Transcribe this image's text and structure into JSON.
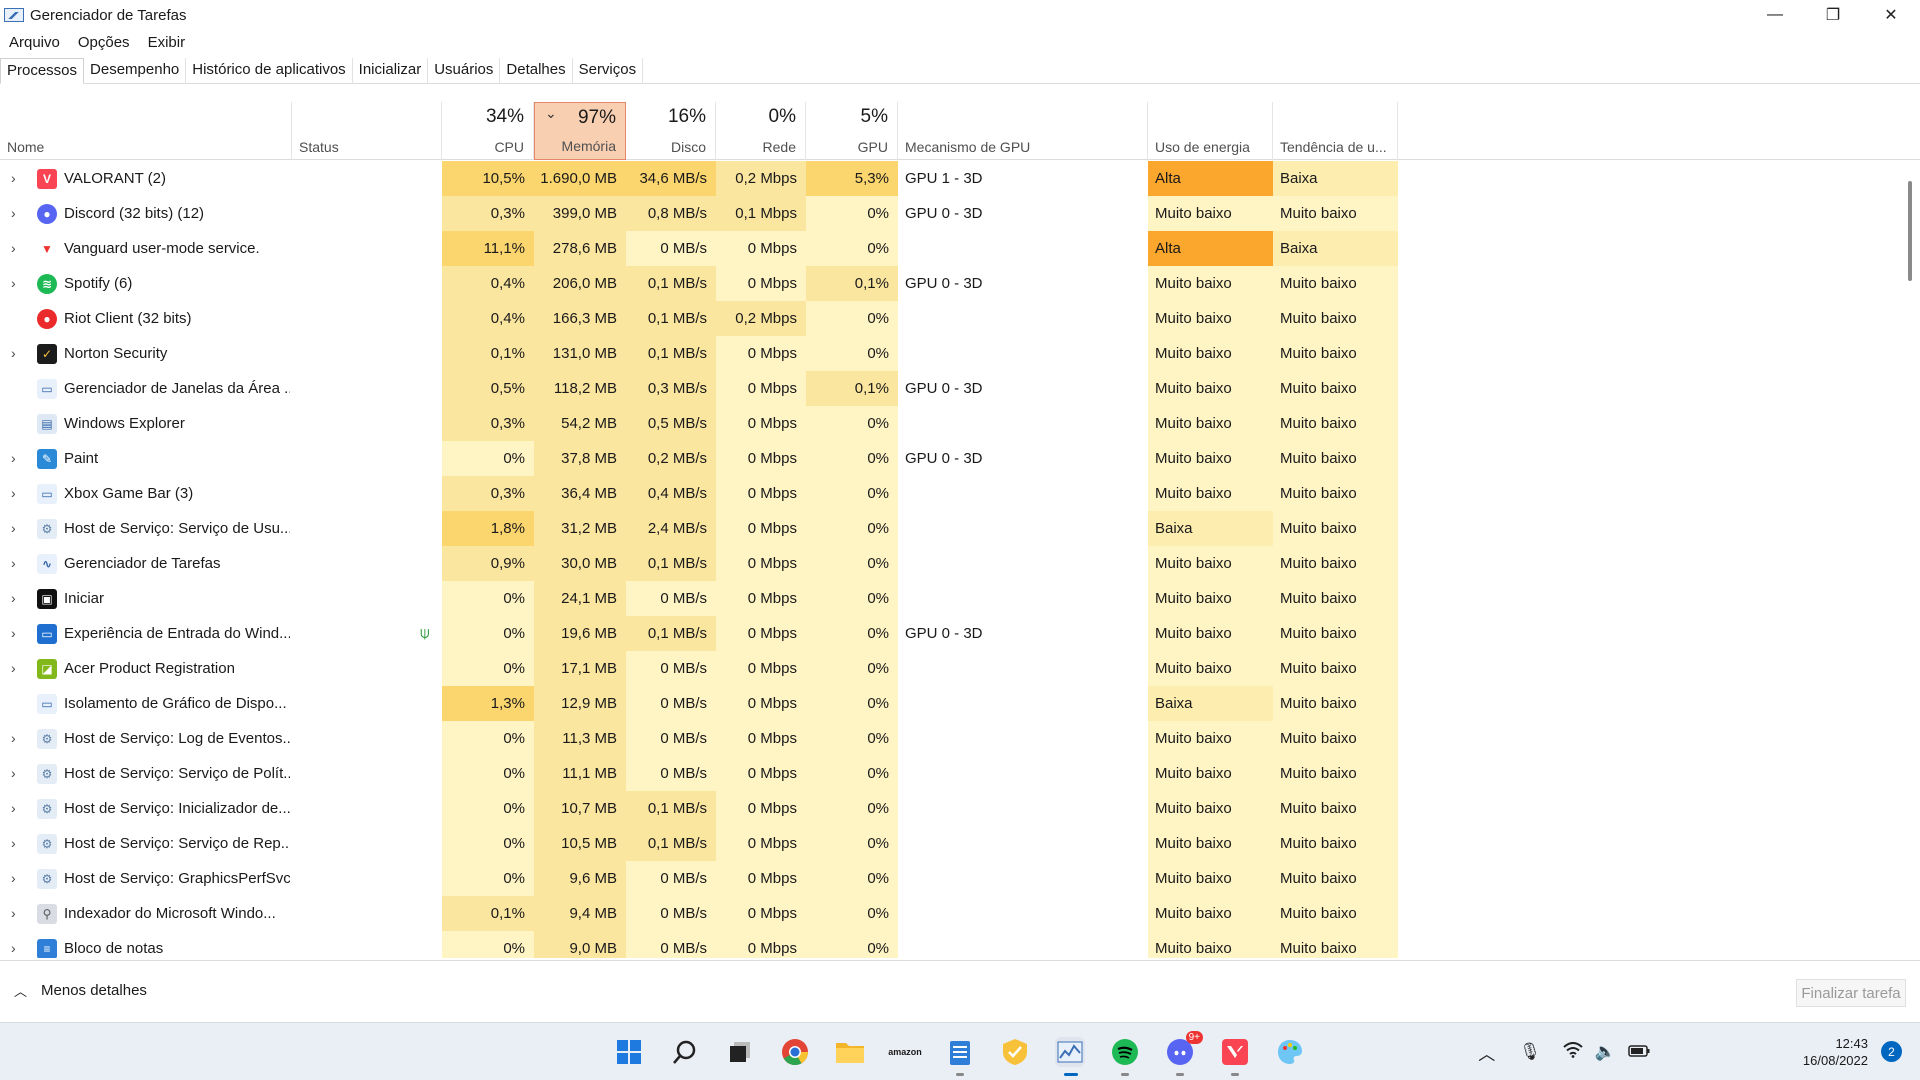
{
  "window": {
    "title": "Gerenciador de Tarefas",
    "minimize": "—",
    "restore": "❐",
    "close": "✕"
  },
  "menu": [
    "Arquivo",
    "Opções",
    "Exibir"
  ],
  "tabs": [
    "Processos",
    "Desempenho",
    "Histórico de aplicativos",
    "Inicializar",
    "Usuários",
    "Detalhes",
    "Serviços"
  ],
  "header": {
    "name": "Nome",
    "status": "Status",
    "cpu_pct": "34%",
    "cpu": "CPU",
    "mem_pct": "97%",
    "mem": "Memória",
    "disk_pct": "16%",
    "disk": "Disco",
    "net_pct": "0%",
    "net": "Rede",
    "gpu_pct": "5%",
    "gpu": "GPU",
    "gpu_engine": "Mecanismo de GPU",
    "power": "Uso de energia",
    "power_trend": "Tendência de u..."
  },
  "processes": [
    {
      "name": "VALORANT (2)",
      "icon": "valorant-icon",
      "exp": true,
      "cpu": "10,5%",
      "mem": "1.690,0 MB",
      "disk": "34,6 MB/s",
      "net": "0,2 Mbps",
      "gpu": "5,3%",
      "engine": "GPU 1 - 3D",
      "power": "Alta",
      "trend": "Baixa"
    },
    {
      "name": "Discord (32 bits) (12)",
      "icon": "discord-icon",
      "exp": true,
      "cpu": "0,3%",
      "mem": "399,0 MB",
      "disk": "0,8 MB/s",
      "net": "0,1 Mbps",
      "gpu": "0%",
      "engine": "GPU 0 - 3D",
      "power": "Muito baixo",
      "trend": "Muito baixo"
    },
    {
      "name": "Vanguard user-mode service.",
      "icon": "vanguard-icon",
      "exp": true,
      "cpu": "11,1%",
      "mem": "278,6 MB",
      "disk": "0 MB/s",
      "net": "0 Mbps",
      "gpu": "0%",
      "engine": "",
      "power": "Alta",
      "trend": "Baixa"
    },
    {
      "name": "Spotify (6)",
      "icon": "spotify-icon",
      "exp": true,
      "cpu": "0,4%",
      "mem": "206,0 MB",
      "disk": "0,1 MB/s",
      "net": "0 Mbps",
      "gpu": "0,1%",
      "engine": "GPU 0 - 3D",
      "power": "Muito baixo",
      "trend": "Muito baixo"
    },
    {
      "name": "Riot Client (32 bits)",
      "icon": "riot-client-icon",
      "exp": false,
      "cpu": "0,4%",
      "mem": "166,3 MB",
      "disk": "0,1 MB/s",
      "net": "0,2 Mbps",
      "gpu": "0%",
      "engine": "",
      "power": "Muito baixo",
      "trend": "Muito baixo"
    },
    {
      "name": "Norton Security",
      "icon": "norton-icon",
      "exp": true,
      "cpu": "0,1%",
      "mem": "131,0 MB",
      "disk": "0,1 MB/s",
      "net": "0 Mbps",
      "gpu": "0%",
      "engine": "",
      "power": "Muito baixo",
      "trend": "Muito baixo"
    },
    {
      "name": "Gerenciador de Janelas da Área ...",
      "icon": "window-icon",
      "exp": false,
      "cpu": "0,5%",
      "mem": "118,2 MB",
      "disk": "0,3 MB/s",
      "net": "0 Mbps",
      "gpu": "0,1%",
      "engine": "GPU 0 - 3D",
      "power": "Muito baixo",
      "trend": "Muito baixo"
    },
    {
      "name": "Windows Explorer",
      "icon": "explorer-icon",
      "exp": false,
      "cpu": "0,3%",
      "mem": "54,2 MB",
      "disk": "0,5 MB/s",
      "net": "0 Mbps",
      "gpu": "0%",
      "engine": "",
      "power": "Muito baixo",
      "trend": "Muito baixo"
    },
    {
      "name": "Paint",
      "icon": "paint-icon",
      "exp": true,
      "cpu": "0%",
      "mem": "37,8 MB",
      "disk": "0,2 MB/s",
      "net": "0 Mbps",
      "gpu": "0%",
      "engine": "GPU 0 - 3D",
      "power": "Muito baixo",
      "trend": "Muito baixo"
    },
    {
      "name": "Xbox Game Bar (3)",
      "icon": "window-icon",
      "exp": true,
      "cpu": "0,3%",
      "mem": "36,4 MB",
      "disk": "0,4 MB/s",
      "net": "0 Mbps",
      "gpu": "0%",
      "engine": "",
      "power": "Muito baixo",
      "trend": "Muito baixo"
    },
    {
      "name": "Host de Serviço: Serviço de Usu...",
      "icon": "service-gear-icon",
      "exp": true,
      "cpu": "1,8%",
      "mem": "31,2 MB",
      "disk": "2,4 MB/s",
      "net": "0 Mbps",
      "gpu": "0%",
      "engine": "",
      "power": "Baixa",
      "trend": "Muito baixo"
    },
    {
      "name": "Gerenciador de Tarefas",
      "icon": "task-manager-icon",
      "exp": true,
      "cpu": "0,9%",
      "mem": "30,0 MB",
      "disk": "0,1 MB/s",
      "net": "0 Mbps",
      "gpu": "0%",
      "engine": "",
      "power": "Muito baixo",
      "trend": "Muito baixo"
    },
    {
      "name": "Iniciar",
      "icon": "start-icon",
      "exp": true,
      "cpu": "0%",
      "mem": "24,1 MB",
      "disk": "0 MB/s",
      "net": "0 Mbps",
      "gpu": "0%",
      "engine": "",
      "power": "Muito baixo",
      "trend": "Muito baixo"
    },
    {
      "name": "Experiência de Entrada do Wind...",
      "icon": "input-experience-icon",
      "exp": true,
      "leaf": true,
      "cpu": "0%",
      "mem": "19,6 MB",
      "disk": "0,1 MB/s",
      "net": "0 Mbps",
      "gpu": "0%",
      "engine": "GPU 0 - 3D",
      "power": "Muito baixo",
      "trend": "Muito baixo"
    },
    {
      "name": "Acer Product Registration",
      "icon": "acer-icon",
      "exp": true,
      "cpu": "0%",
      "mem": "17,1 MB",
      "disk": "0 MB/s",
      "net": "0 Mbps",
      "gpu": "0%",
      "engine": "",
      "power": "Muito baixo",
      "trend": "Muito baixo"
    },
    {
      "name": "Isolamento de Gráfico de Dispo...",
      "icon": "window-icon",
      "exp": false,
      "cpu": "1,3%",
      "mem": "12,9 MB",
      "disk": "0 MB/s",
      "net": "0 Mbps",
      "gpu": "0%",
      "engine": "",
      "power": "Baixa",
      "trend": "Muito baixo"
    },
    {
      "name": "Host de Serviço: Log de Eventos...",
      "icon": "service-gear-icon",
      "exp": true,
      "cpu": "0%",
      "mem": "11,3 MB",
      "disk": "0 MB/s",
      "net": "0 Mbps",
      "gpu": "0%",
      "engine": "",
      "power": "Muito baixo",
      "trend": "Muito baixo"
    },
    {
      "name": "Host de Serviço: Serviço de Polít...",
      "icon": "service-gear-icon",
      "exp": true,
      "cpu": "0%",
      "mem": "11,1 MB",
      "disk": "0 MB/s",
      "net": "0 Mbps",
      "gpu": "0%",
      "engine": "",
      "power": "Muito baixo",
      "trend": "Muito baixo"
    },
    {
      "name": "Host de Serviço: Inicializador de...",
      "icon": "service-gear-icon",
      "exp": true,
      "cpu": "0%",
      "mem": "10,7 MB",
      "disk": "0,1 MB/s",
      "net": "0 Mbps",
      "gpu": "0%",
      "engine": "",
      "power": "Muito baixo",
      "trend": "Muito baixo"
    },
    {
      "name": "Host de Serviço: Serviço de Rep...",
      "icon": "service-gear-icon",
      "exp": true,
      "cpu": "0%",
      "mem": "10,5 MB",
      "disk": "0,1 MB/s",
      "net": "0 Mbps",
      "gpu": "0%",
      "engine": "",
      "power": "Muito baixo",
      "trend": "Muito baixo"
    },
    {
      "name": "Host de Serviço: GraphicsPerfSvc",
      "icon": "service-gear-icon",
      "exp": true,
      "cpu": "0%",
      "mem": "9,6 MB",
      "disk": "0 MB/s",
      "net": "0 Mbps",
      "gpu": "0%",
      "engine": "",
      "power": "Muito baixo",
      "trend": "Muito baixo"
    },
    {
      "name": "Indexador do Microsoft Windo...",
      "icon": "indexer-icon",
      "exp": true,
      "cpu": "0,1%",
      "mem": "9,4 MB",
      "disk": "0 MB/s",
      "net": "0 Mbps",
      "gpu": "0%",
      "engine": "",
      "power": "Muito baixo",
      "trend": "Muito baixo"
    },
    {
      "name": "Bloco de notas",
      "icon": "notepad-icon",
      "exp": true,
      "cpu": "0%",
      "mem": "9,0 MB",
      "disk": "0 MB/s",
      "net": "0 Mbps",
      "gpu": "0%",
      "engine": "",
      "power": "Muito baixo",
      "trend": "Muito baixo"
    }
  ],
  "footer": {
    "less_details": "Menos detalhes",
    "end_task": "Finalizar tarefa"
  },
  "taskbar": {
    "icons": [
      "windows-start-icon",
      "search-icon",
      "task-view-icon",
      "chrome-icon",
      "file-explorer-icon",
      "amazon-icon",
      "notepad-icon",
      "norton-icon",
      "task-manager-icon",
      "spotify-icon",
      "discord-icon",
      "valorant-icon",
      "paint-icon"
    ],
    "discord_badge": "9+",
    "time": "12:43",
    "date": "16/08/2022",
    "notifications": "2"
  },
  "colors": {
    "heat_low": "#fff4c4",
    "heat_mid": "#fbe6a0",
    "heat_high": "#fbd56e",
    "power_high": "#fba72d",
    "power_low": "#fdeeb0",
    "sorted_header": "#f9cfb2"
  }
}
